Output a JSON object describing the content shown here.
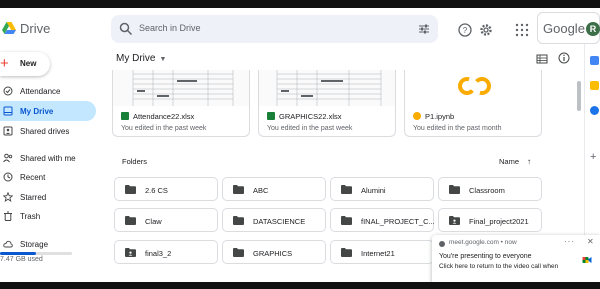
{
  "app": {
    "title": "Drive"
  },
  "header": {
    "search_placeholder": "Search in Drive",
    "account_brand": "Google",
    "avatar_letter": "R"
  },
  "sidebar": {
    "new_label": "New",
    "items": [
      {
        "label": "Attendance",
        "icon": "checkbox-icon"
      },
      {
        "label": "My Drive",
        "icon": "my-drive-icon",
        "active": true
      },
      {
        "label": "Shared drives",
        "icon": "shared-drives-icon"
      },
      {
        "label": "Shared with me",
        "icon": "people-icon"
      },
      {
        "label": "Recent",
        "icon": "clock-icon"
      },
      {
        "label": "Starred",
        "icon": "star-icon"
      },
      {
        "label": "Trash",
        "icon": "trash-icon"
      },
      {
        "label": "Storage",
        "icon": "cloud-icon"
      }
    ],
    "storage_text": "7.47 GB used",
    "storage_fraction": 0.5
  },
  "main": {
    "title": "My Drive",
    "files": [
      {
        "name": "Attendance22.xlsx",
        "meta": "You edited in the past week",
        "type": "xlsx"
      },
      {
        "name": "GRAPHICS22.xlsx",
        "meta": "You edited in the past week",
        "type": "xlsx"
      },
      {
        "name": "P1.ipynb",
        "meta": "You edited in the past month",
        "type": "colab"
      }
    ],
    "folders_label": "Folders",
    "sort_label": "Name",
    "folders": [
      {
        "name": "2.6 CS",
        "shared": false
      },
      {
        "name": "ABC",
        "shared": false
      },
      {
        "name": "Alumini",
        "shared": false
      },
      {
        "name": "Classroom",
        "shared": false
      },
      {
        "name": "Claw",
        "shared": false
      },
      {
        "name": "DATASCIENCE",
        "shared": false
      },
      {
        "name": "fINAL_PROJECT_C...",
        "shared": false
      },
      {
        "name": "Final_project2021",
        "shared": true
      },
      {
        "name": "final3_2",
        "shared": true
      },
      {
        "name": "GRAPHICS",
        "shared": false
      },
      {
        "name": "Internet21",
        "shared": false
      }
    ]
  },
  "notification": {
    "source": "meet.google.com • now",
    "title": "You're presenting to everyone",
    "body": "Click here to return to the video call when"
  },
  "colors": {
    "accent": "#0b57d0",
    "active_bg": "#c2e7ff",
    "excel_green": "#188038",
    "colab_orange": "#f9ab00"
  }
}
